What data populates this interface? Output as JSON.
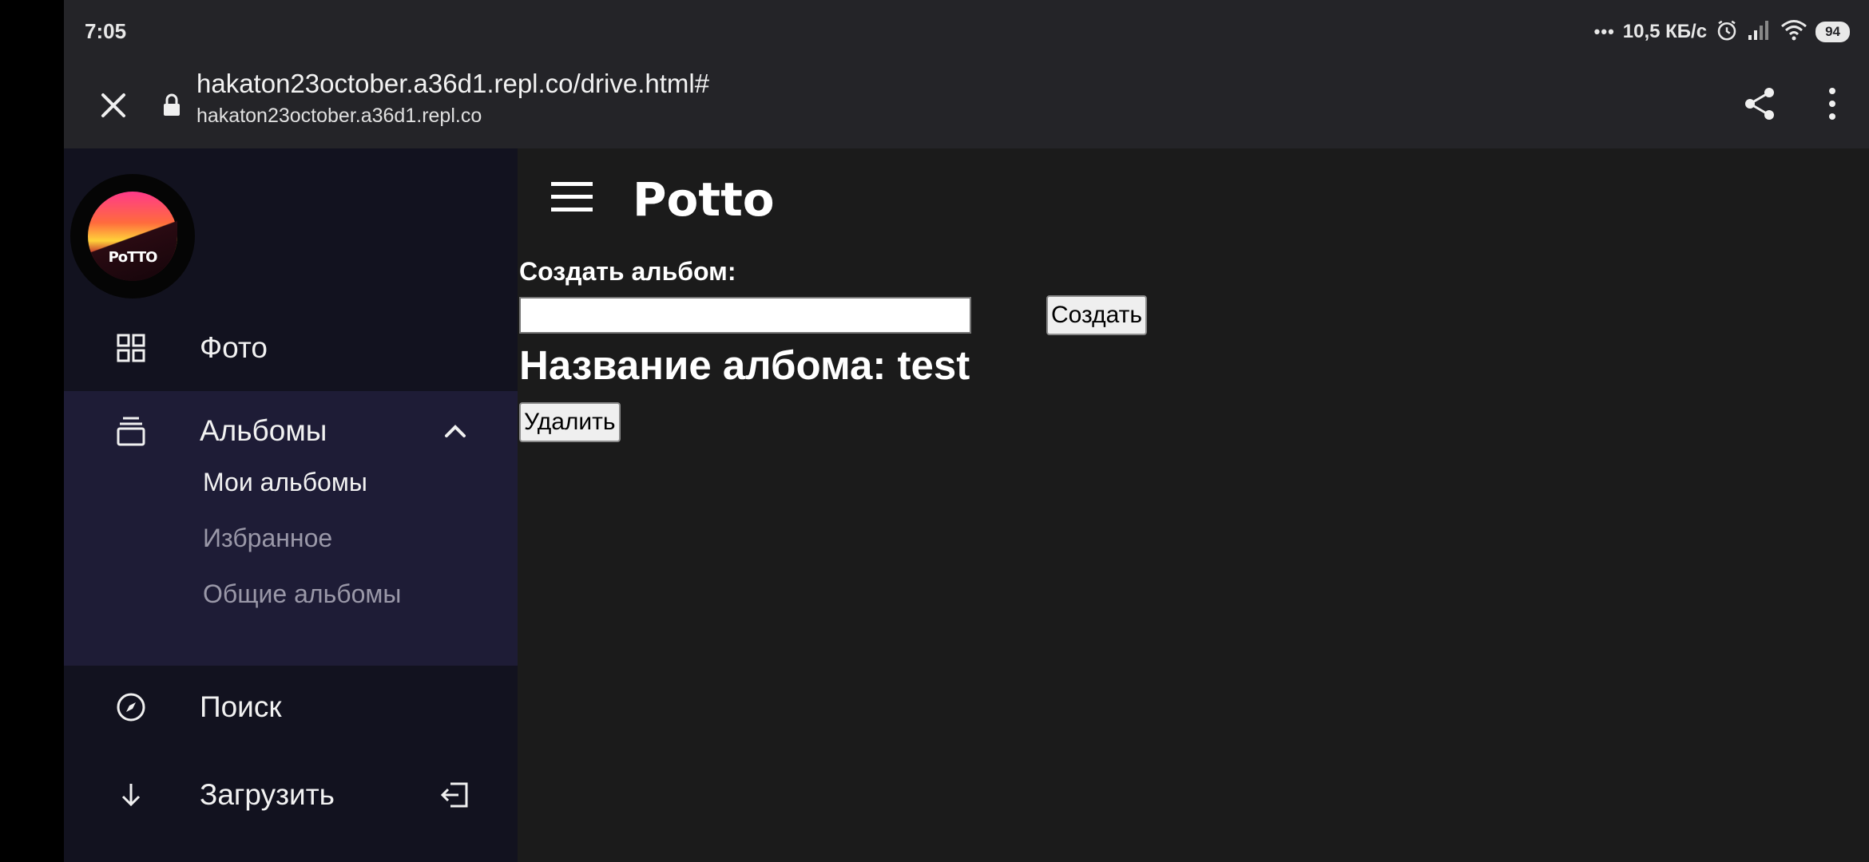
{
  "status_bar": {
    "time": "7:05",
    "speed": "10,5 КБ/с",
    "battery": "94",
    "icons": [
      "more-dots-icon",
      "alarm-icon",
      "signal-icon",
      "wifi-icon",
      "battery-icon"
    ]
  },
  "toolbar": {
    "url": "hakaton23october.a36d1.repl.co/drive.html#",
    "host": "hakaton23october.a36d1.repl.co",
    "icons": [
      "close-icon",
      "lock-icon",
      "share-icon",
      "more-vert-icon"
    ]
  },
  "sidebar": {
    "logo_text": "PoTTO",
    "items": [
      {
        "label": "Фото",
        "icon": "grid-icon"
      },
      {
        "label": "Альбомы",
        "icon": "albums-icon",
        "expanded": true
      },
      {
        "label": "Поиск",
        "icon": "compass-icon"
      },
      {
        "label": "Загрузить",
        "icon": "download-icon"
      }
    ],
    "albums_sub": [
      {
        "label": "Мои альбомы",
        "active": true
      },
      {
        "label": "Избранное",
        "active": false
      },
      {
        "label": "Общие альбомы",
        "active": false
      }
    ]
  },
  "main": {
    "title": "Potto",
    "create_label": "Создать альбом:",
    "create_input_value": "",
    "create_button": "Создать",
    "album_name": "Название албома: test",
    "delete_button": "Удалить"
  },
  "colors": {
    "sidebar_bg": "#12121f",
    "albums_block_bg": "#1e1c36",
    "main_bg": "#1b1b1b",
    "toolbar_bg": "#242428",
    "sub_inactive": "#9a98a8"
  }
}
